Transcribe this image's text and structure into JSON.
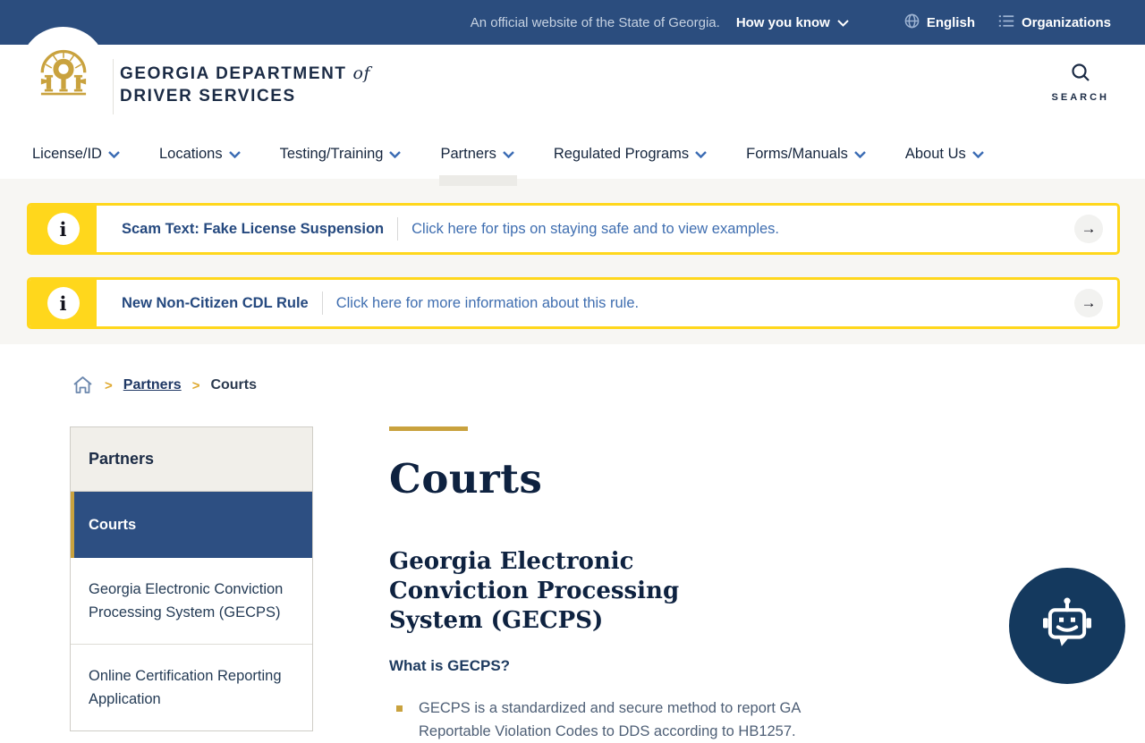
{
  "topbar": {
    "official_text": "An official website of the State of Georgia.",
    "how_you_know_label": "How you know",
    "language_label": "English",
    "organizations_label": "Organizations"
  },
  "header": {
    "brand_line1": "GEORGIA DEPARTMENT",
    "brand_of": "of",
    "brand_line2": "DRIVER SERVICES",
    "search_label": "SEARCH"
  },
  "nav": {
    "items": [
      {
        "label": "License/ID"
      },
      {
        "label": "Locations"
      },
      {
        "label": "Testing/Training"
      },
      {
        "label": "Partners"
      },
      {
        "label": "Regulated Programs"
      },
      {
        "label": "Forms/Manuals"
      },
      {
        "label": "About Us"
      }
    ]
  },
  "alerts": [
    {
      "info_glyph": "i",
      "title": "Scam Text: Fake License Suspension",
      "message": "Click here for tips on staying safe and to view examples.",
      "arrow_glyph": "→"
    },
    {
      "info_glyph": "i",
      "title": "New Non-Citizen CDL Rule",
      "message": "Click here for more information about this rule.",
      "arrow_glyph": "→"
    }
  ],
  "breadcrumb": {
    "sep1": ">",
    "link1": "Partners",
    "sep2": ">",
    "current": "Courts"
  },
  "sidebar": {
    "title": "Partners",
    "items": [
      {
        "label": "Courts"
      },
      {
        "label": "Georgia Electronic Conviction Processing System (GECPS)"
      },
      {
        "label": "Online Certification Reporting Application"
      }
    ]
  },
  "main": {
    "page_title": "Courts",
    "section_heading": "Georgia Electronic Conviction Processing System (GECPS)",
    "question_heading": "What is GECPS?",
    "bullet_1": "GECPS is a standardized and secure method to report GA Reportable Violation Codes to DDS according to HB1257."
  },
  "colors": {
    "topbar_blue": "#2b4d7e",
    "accent_gold": "#c9a23e",
    "alert_yellow": "#ffd71c",
    "active_item_blue": "#2d4f82",
    "link_blue": "#3f6eb0",
    "navy_text": "#1b2b45",
    "chat_navy": "#14395e"
  }
}
